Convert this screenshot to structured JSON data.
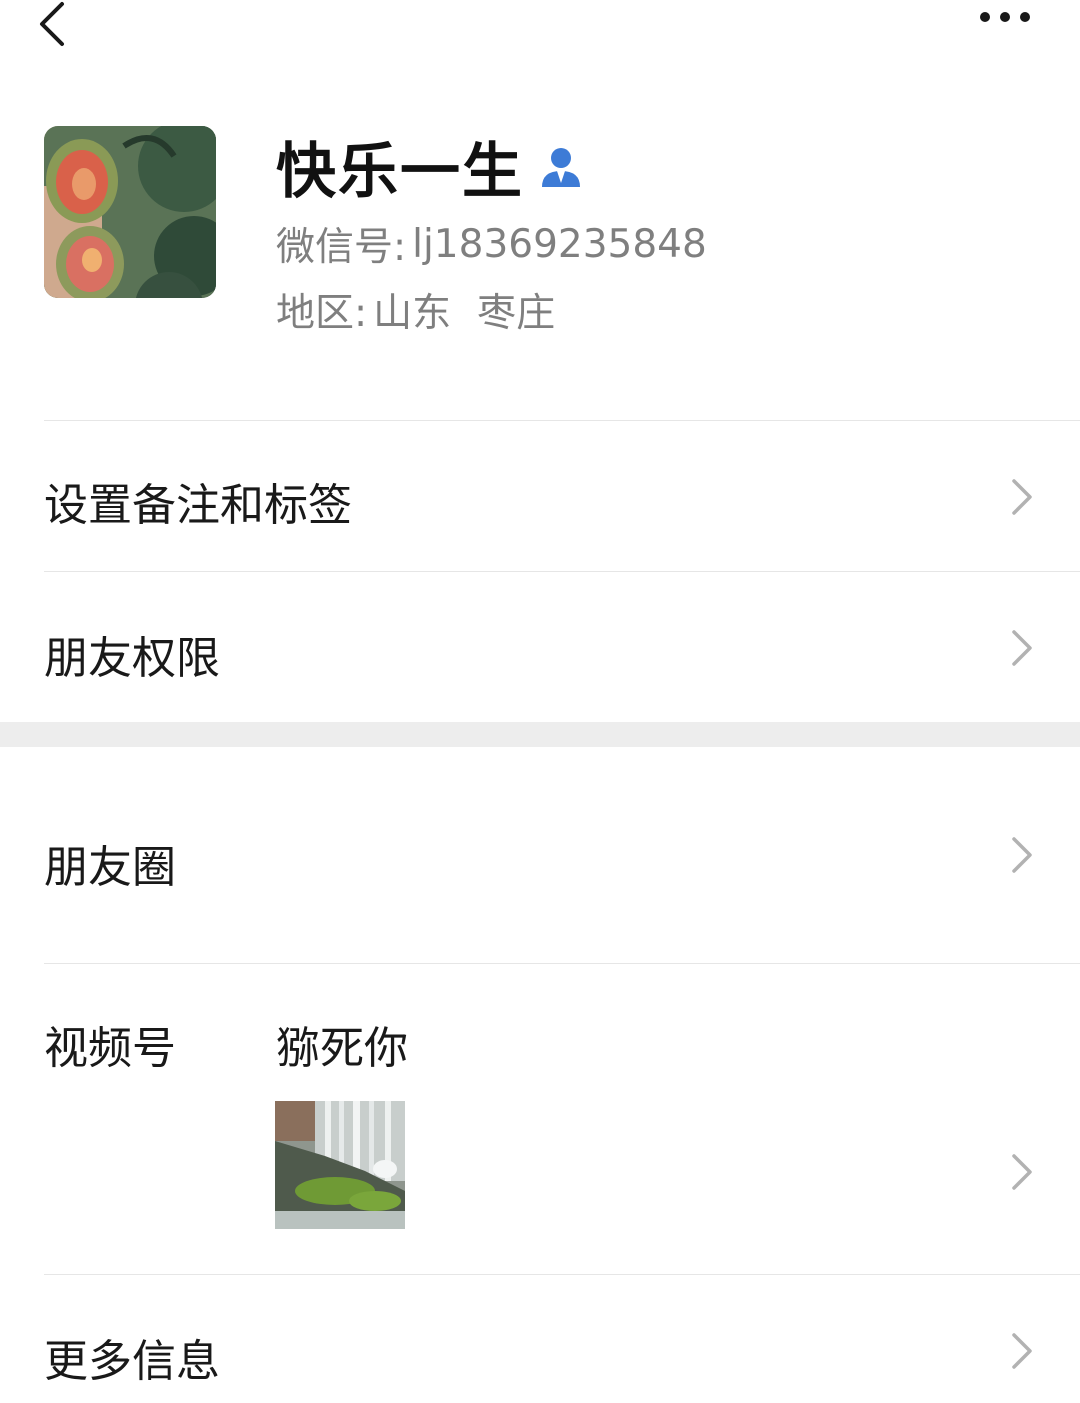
{
  "header": {
    "back_icon": "chevron-left-icon",
    "more_icon": "more-horizontal-icon"
  },
  "profile": {
    "nickname": "快乐一生",
    "wechat_id_label": "微信号:",
    "wechat_id": "lj18369235848",
    "region_label": "地区:",
    "region_province": "山东",
    "region_city": "枣庄",
    "avatar_icon": "profile-photo",
    "contact_icon": "contact-person-icon"
  },
  "menu": {
    "remarks_tags": "设置备注和标签",
    "friend_permissions": "朋友权限",
    "moments": "朋友圈",
    "channels": "视频号",
    "channels_name": "猕死你",
    "more_info": "更多信息"
  },
  "colors": {
    "accent_blue": "#3d7bd6",
    "text_primary": "#191919",
    "text_secondary": "#7f7f7f",
    "divider": "#e6e6e6",
    "section_gap": "#ededed",
    "chevron": "#b2b2b2"
  }
}
